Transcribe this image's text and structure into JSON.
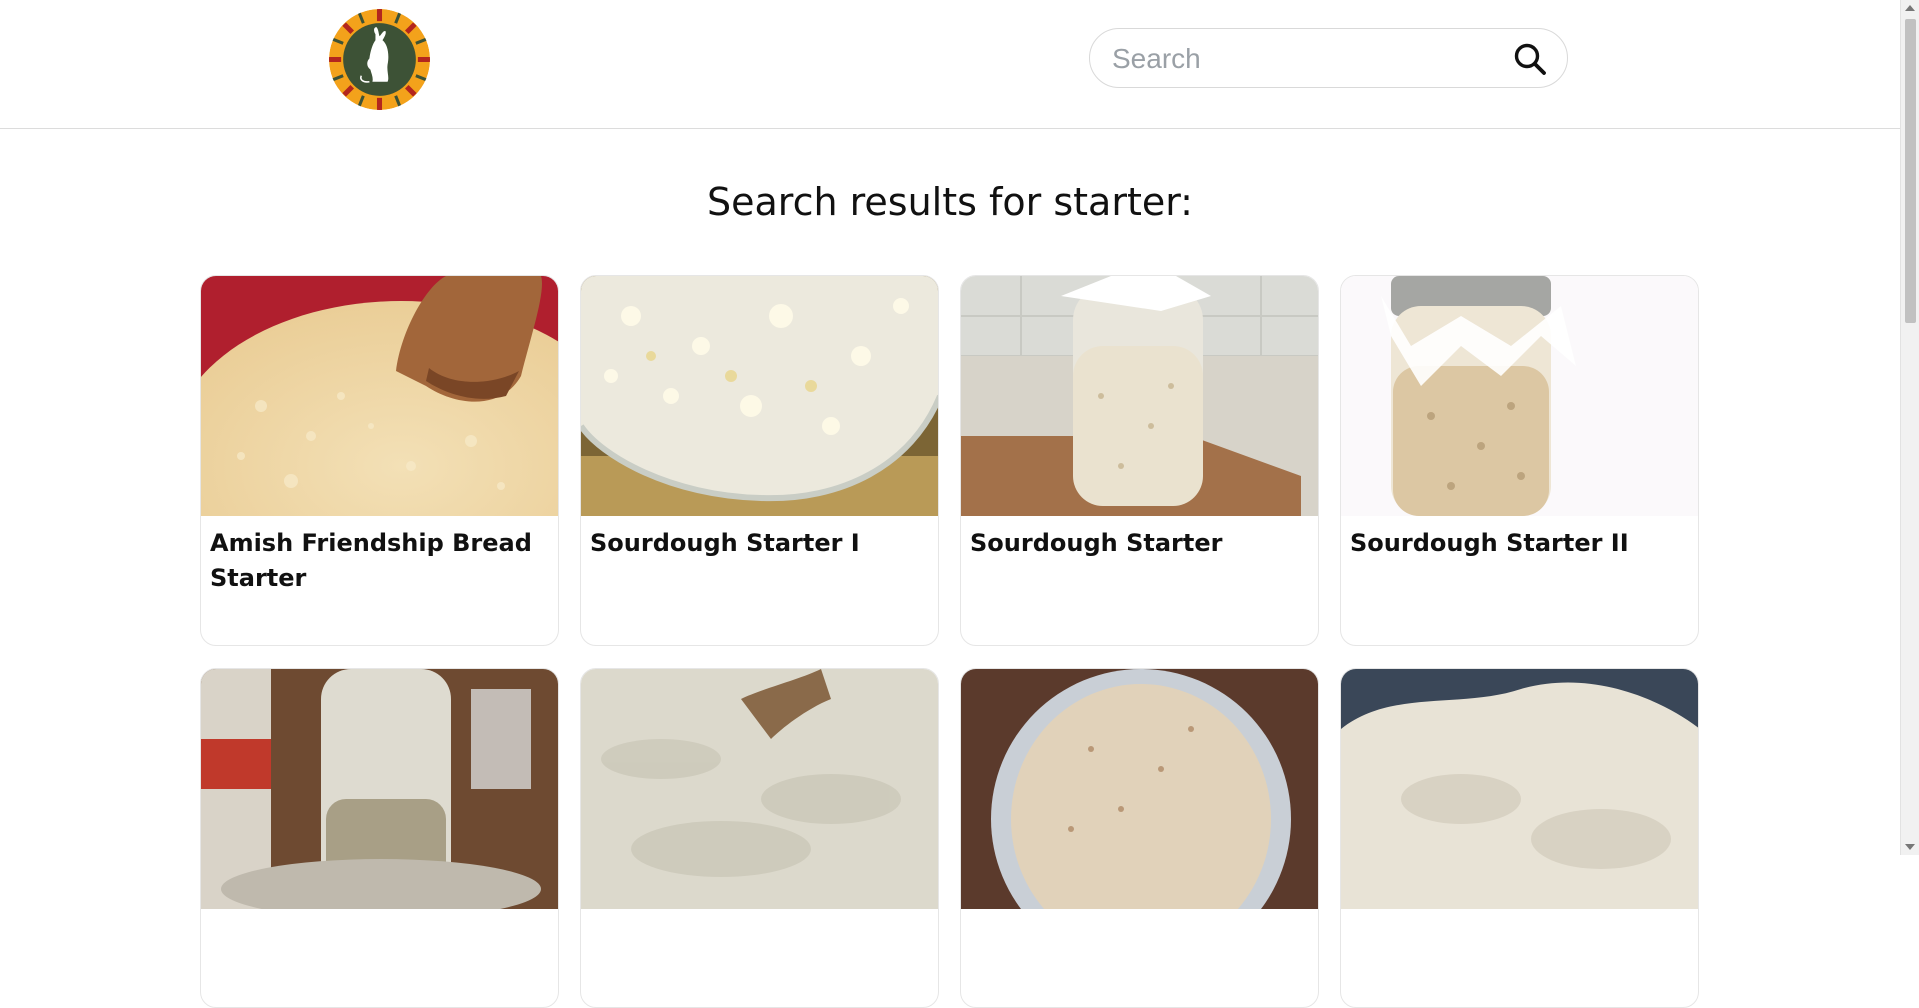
{
  "header": {
    "search_placeholder": "Search"
  },
  "results": {
    "heading": "Search results for starter:"
  },
  "recipes": [
    {
      "title": "Amish Friendship Bread Starter"
    },
    {
      "title": "Sourdough Starter I"
    },
    {
      "title": "Sourdough Starter"
    },
    {
      "title": "Sourdough Starter II"
    },
    {
      "title": ""
    },
    {
      "title": ""
    },
    {
      "title": ""
    },
    {
      "title": ""
    }
  ],
  "icons": {
    "search": "search-icon",
    "logo": "rabbit-logo-icon"
  },
  "colors": {
    "logo_green": "#3d5236",
    "logo_orange": "#f3a21b",
    "logo_red": "#b3261e",
    "border": "#dcdcdc"
  }
}
